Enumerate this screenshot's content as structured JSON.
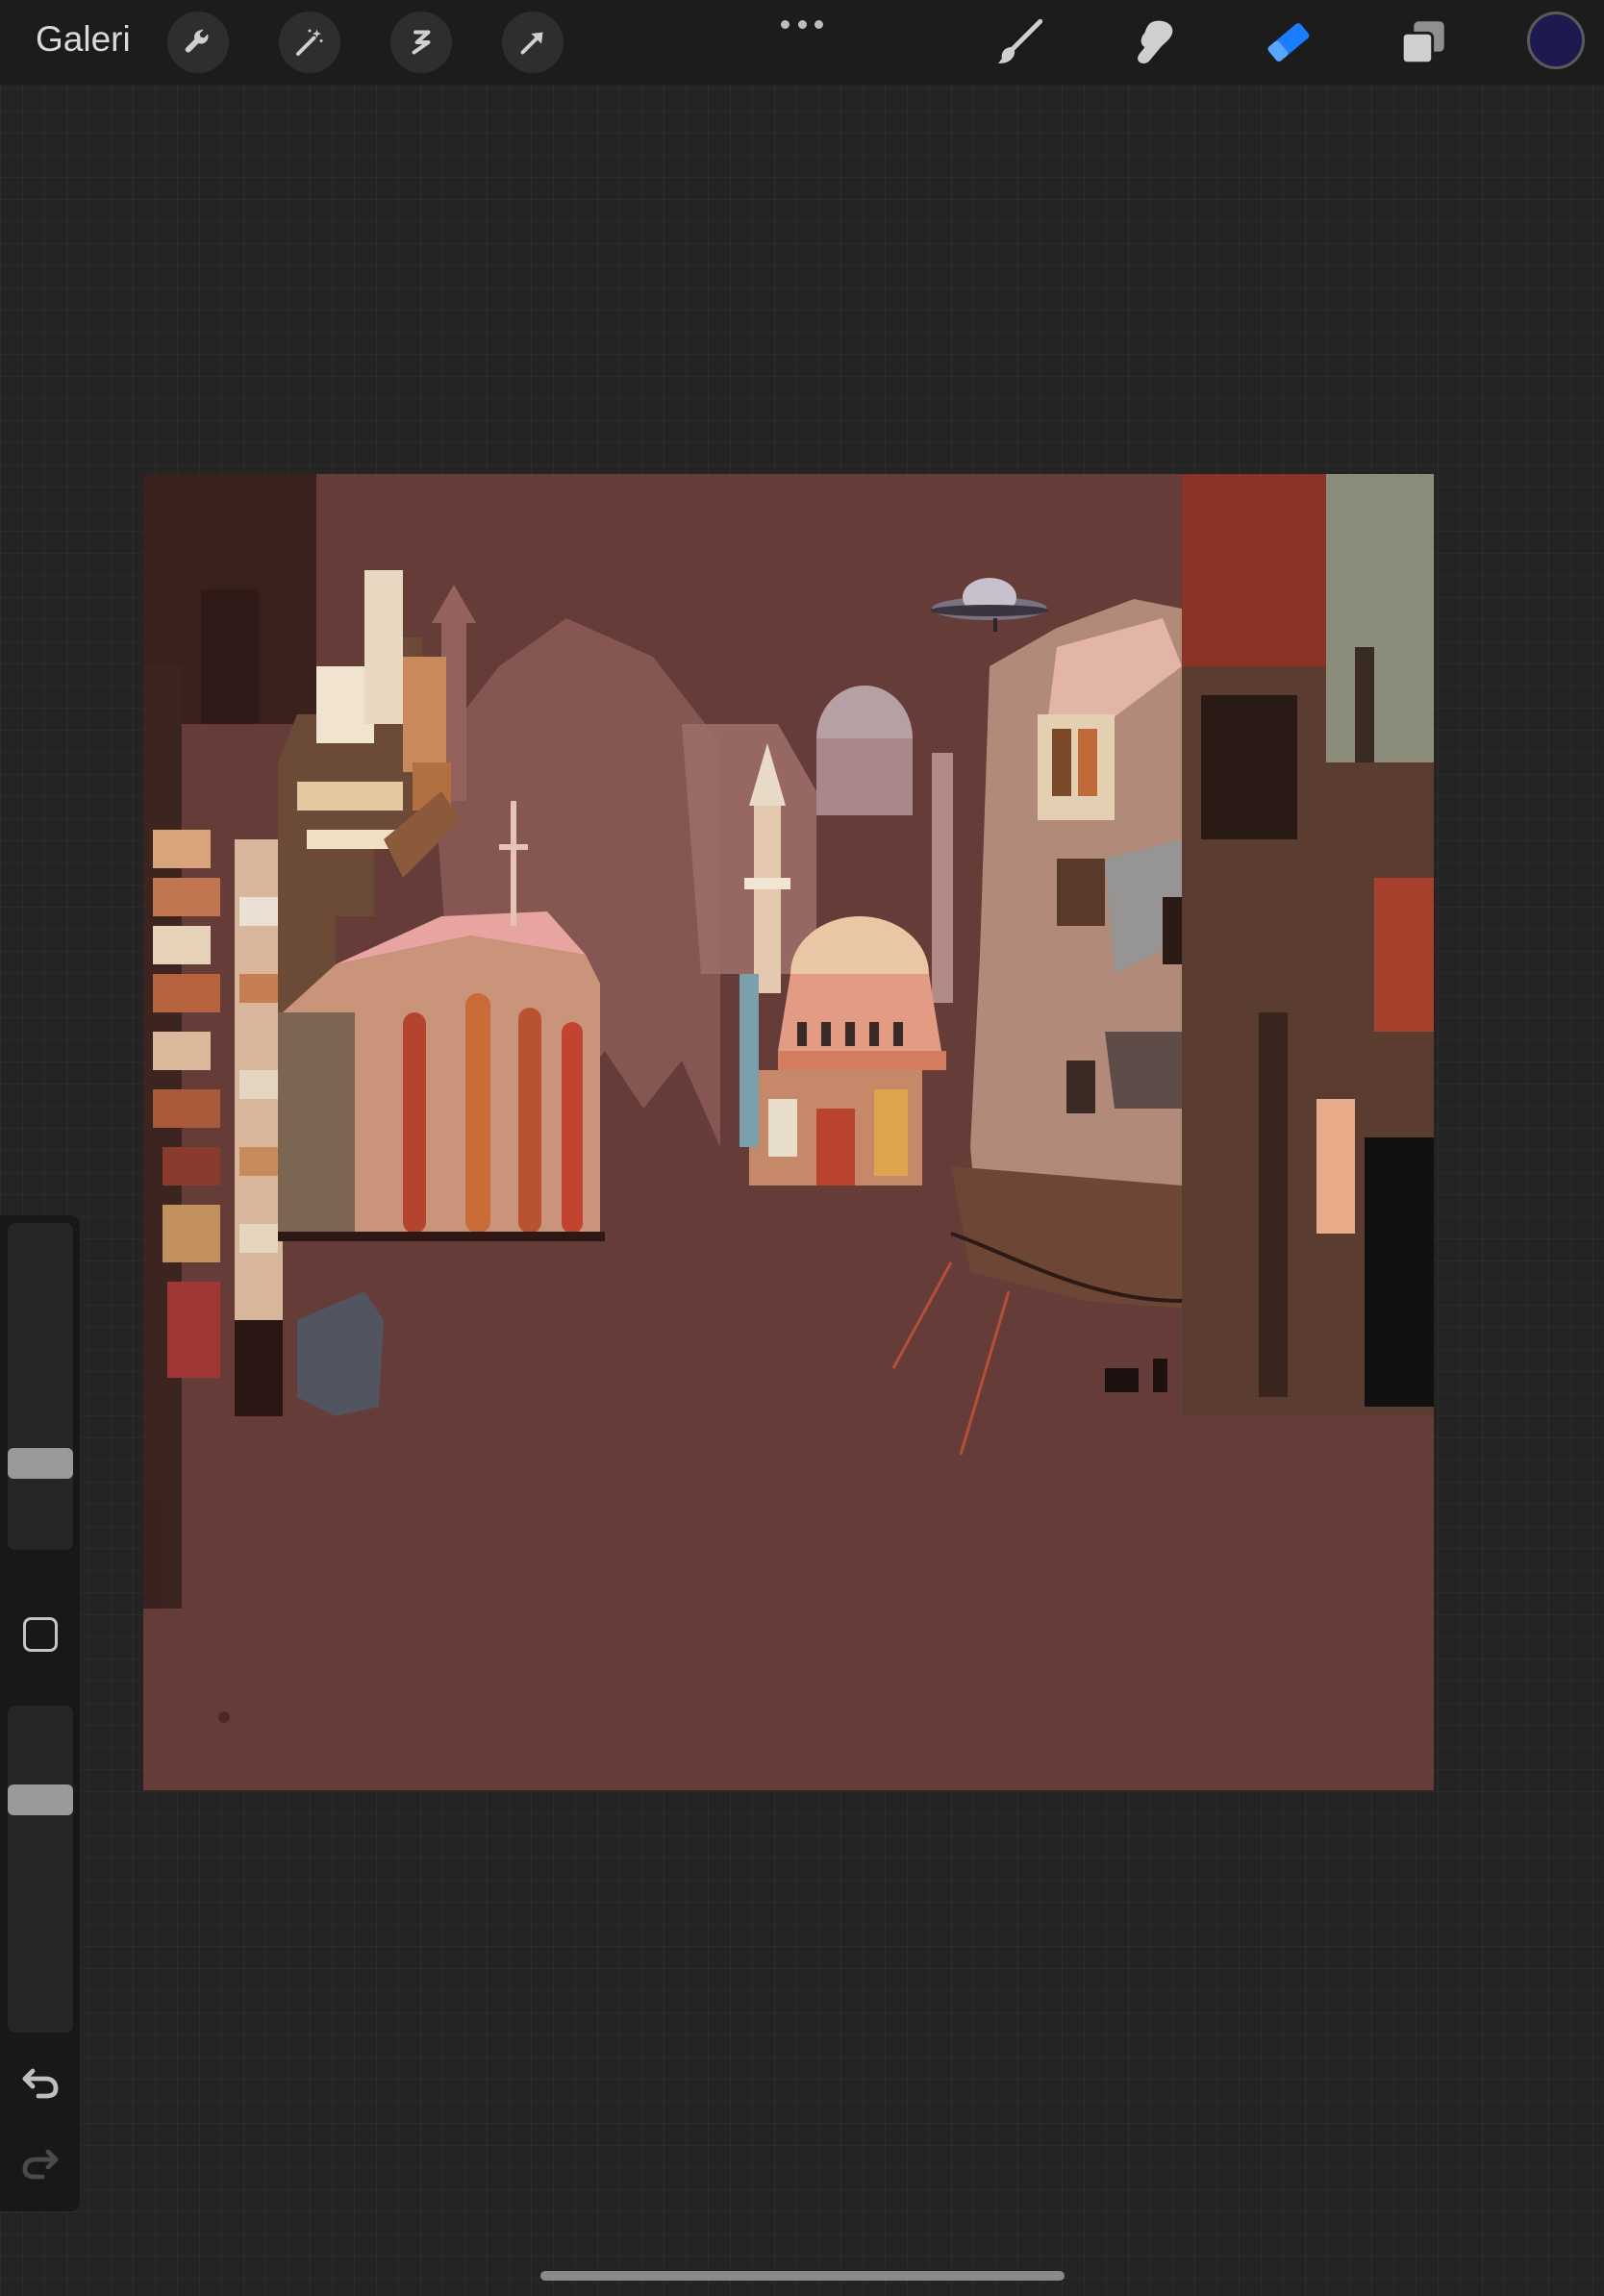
{
  "topbar": {
    "gallery_label": "Galeri",
    "left_tools": [
      {
        "icon": "wrench-icon",
        "name": "actions"
      },
      {
        "icon": "magic-wand-icon",
        "name": "adjustments"
      },
      {
        "icon": "selection-icon",
        "name": "selection"
      },
      {
        "icon": "arrow-cursor-icon",
        "name": "transform"
      }
    ],
    "right_tools": [
      {
        "icon": "brush-icon",
        "name": "paint"
      },
      {
        "icon": "smudge-icon",
        "name": "smudge"
      },
      {
        "icon": "eraser-icon",
        "name": "erase",
        "active": true
      },
      {
        "icon": "layers-icon",
        "name": "layers"
      }
    ],
    "current_color": "#1c1a4e",
    "active_color": "#1a7cff"
  },
  "sidebar": {
    "brush_size_level": 0.32,
    "opacity_level": 0.74
  },
  "canvas": {
    "background_color": "#653c38"
  }
}
